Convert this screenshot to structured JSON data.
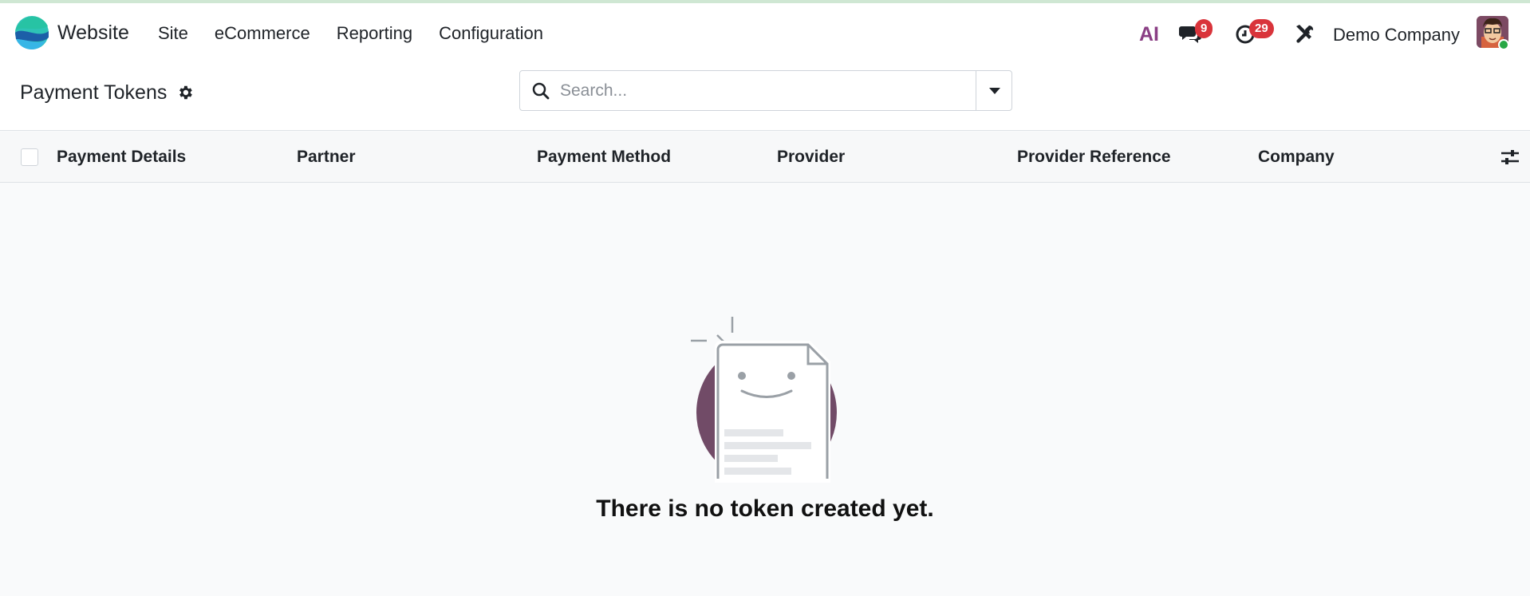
{
  "app": {
    "name": "Website"
  },
  "menu": [
    {
      "label": "Site"
    },
    {
      "label": "eCommerce"
    },
    {
      "label": "Reporting"
    },
    {
      "label": "Configuration"
    }
  ],
  "systray": {
    "ai_label": "AI",
    "messages_count": "9",
    "activities_count": "29",
    "company": "Demo Company"
  },
  "control_panel": {
    "title": "Payment Tokens",
    "search_placeholder": "Search..."
  },
  "table": {
    "columns": [
      {
        "label": "Payment Details"
      },
      {
        "label": "Partner"
      },
      {
        "label": "Payment Method"
      },
      {
        "label": "Provider"
      },
      {
        "label": "Provider Reference"
      },
      {
        "label": "Company"
      }
    ]
  },
  "empty_state": {
    "title": "There is no token created yet."
  },
  "colors": {
    "brand_accent": "#714b67",
    "badge": "#d9343b",
    "online": "#29a745"
  }
}
